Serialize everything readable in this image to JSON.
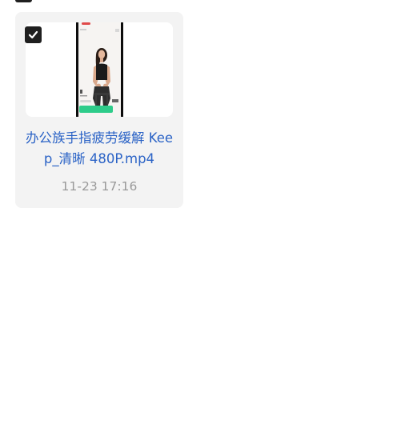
{
  "files": [
    {
      "name": "办公族手指疲劳缓解 Keep_清晰 480P.mp4",
      "modified": "11-23 17:16",
      "selected": true,
      "thumbnail_icon": "video-thumbnail"
    }
  ],
  "colors": {
    "card_bg": "#f3f3f3",
    "filename": "#2b63c6",
    "date": "#999999",
    "checkbox": "#1f1f1f",
    "accent_green": "#2ecc8a"
  }
}
